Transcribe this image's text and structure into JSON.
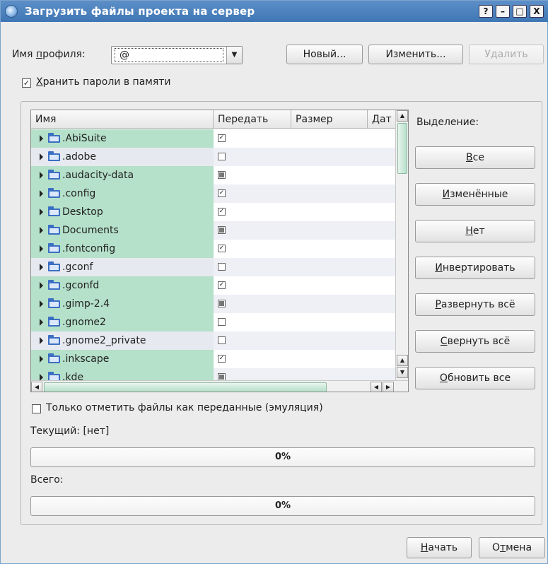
{
  "titlebar": {
    "title": "Загрузить файлы проекта на сервер",
    "buttons": [
      "?",
      "–",
      "□",
      "X"
    ]
  },
  "profile": {
    "label_pre": "Имя ",
    "label_accel": "п",
    "label_post": "рофиля:",
    "value": "@",
    "new_label": "Новый...",
    "edit_label": "Изменить...",
    "delete_label": "Удалить"
  },
  "store_passwords": {
    "checked": true,
    "accel": "Х",
    "rest": "ранить пароли в памяти"
  },
  "tree": {
    "columns": [
      "Имя",
      "Передать",
      "Размер",
      "Дат"
    ],
    "rows": [
      {
        "name": ".AbiSuite",
        "transfer": "checked"
      },
      {
        "name": ".adobe",
        "transfer": "unchecked"
      },
      {
        "name": ".audacity-data",
        "transfer": "partial"
      },
      {
        "name": ".config",
        "transfer": "checked"
      },
      {
        "name": "Desktop",
        "transfer": "checked"
      },
      {
        "name": "Documents",
        "transfer": "partial"
      },
      {
        "name": ".fontconfig",
        "transfer": "checked"
      },
      {
        "name": ".gconf",
        "transfer": "unchecked"
      },
      {
        "name": ".gconfd",
        "transfer": "checked"
      },
      {
        "name": ".gimp-2.4",
        "transfer": "partial"
      },
      {
        "name": ".gnome2",
        "transfer": "unchecked"
      },
      {
        "name": ".gnome2_private",
        "transfer": "unchecked"
      },
      {
        "name": ".inkscape",
        "transfer": "checked"
      },
      {
        "name": ".kde",
        "transfer": "partial"
      }
    ]
  },
  "selection": {
    "label": "Выделение:",
    "buttons": [
      {
        "accel": "В",
        "rest": "се"
      },
      {
        "accel": "И",
        "rest": "зменённые"
      },
      {
        "accel": "Н",
        "rest": "ет"
      },
      {
        "accel": "И",
        "rest": "нвертировать"
      },
      {
        "accel": "Р",
        "rest": "азвернуть всё"
      },
      {
        "accel": "С",
        "rest": "вернуть всё"
      },
      {
        "accel": "О",
        "rest": "бновить все"
      }
    ]
  },
  "emulation": {
    "checked": false,
    "label": "Только отметить файлы как переданные (эмуляция)"
  },
  "current": {
    "label": "Текущий: [нет]",
    "progress": 0,
    "progress_text": "0%"
  },
  "total": {
    "label": "Всего:",
    "progress": 0,
    "progress_text": "0%"
  },
  "footer": {
    "start_accel": "Н",
    "start_rest": "ачать",
    "cancel_pre": "О",
    "cancel_accel": "т",
    "cancel_post": "мена"
  }
}
